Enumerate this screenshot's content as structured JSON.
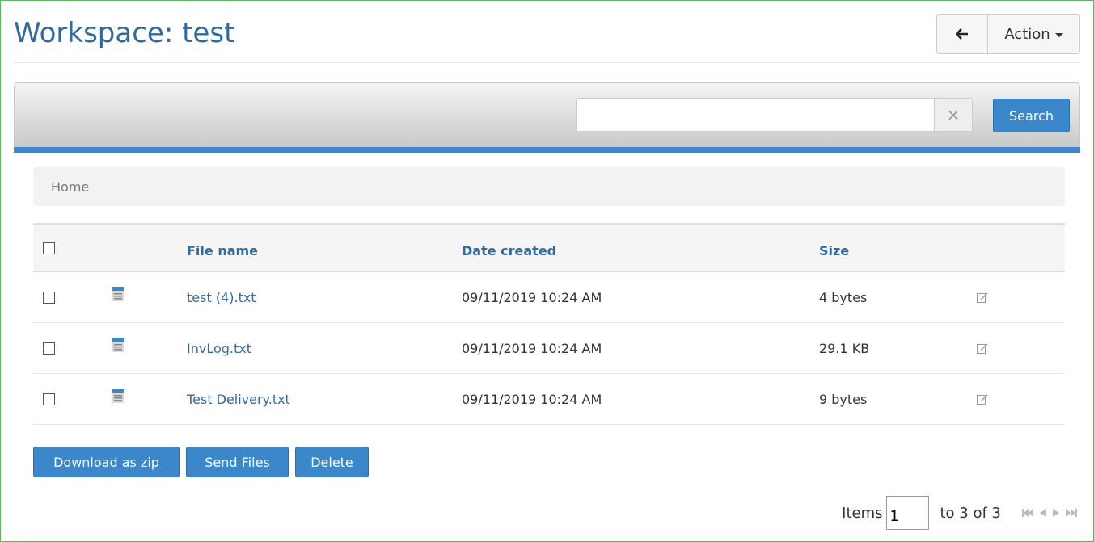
{
  "header": {
    "title": "Workspace: test",
    "back_icon": "arrow-left-icon",
    "action_label": "Action"
  },
  "search": {
    "value": "",
    "placeholder": "",
    "clear_label": "×",
    "button_label": "Search"
  },
  "breadcrumb": {
    "home_label": "Home"
  },
  "table": {
    "columns": {
      "file_name": "File name",
      "date_created": "Date created",
      "size": "Size"
    },
    "rows": [
      {
        "name": "test (4).txt",
        "date": "09/11/2019 10:24 AM",
        "size": "4 bytes"
      },
      {
        "name": "InvLog.txt",
        "date": "09/11/2019 10:24 AM",
        "size": "29.1 KB"
      },
      {
        "name": "Test Delivery.txt",
        "date": "09/11/2019 10:24 AM",
        "size": "9 bytes"
      }
    ]
  },
  "actions": {
    "download_label": "Download as zip",
    "send_label": "Send Files",
    "delete_label": "Delete"
  },
  "pager": {
    "items_label": "Items",
    "page_value": "1",
    "range_label": "to 3 of 3"
  },
  "colors": {
    "primary": "#3a87cc",
    "title": "#2f6aa3",
    "frame_border": "#5cb85c",
    "toolbar_rule": "#3c86d1"
  }
}
